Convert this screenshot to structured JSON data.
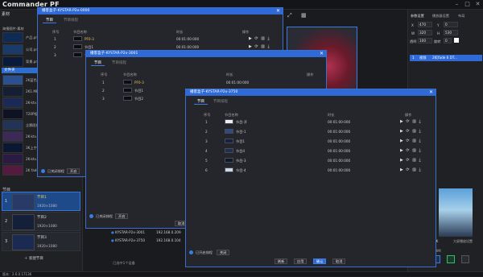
{
  "app": {
    "title": "Commander PF",
    "version_label": "版本：2.6.0.17136"
  },
  "left": {
    "header": "素材",
    "subheader": "海报图片-素材",
    "files": [
      "产品.png",
      "公司.png",
      "背景.png"
    ],
    "folder": "文件夹",
    "items": [
      "2K蓝色...",
      "2K1.MP4",
      "2K-ktv...",
      "720P视频",
      "企鹅图片",
      "2K-ktv...",
      "3K上宁吧",
      "2K-ktv...",
      "2K fade...",
      "公司展示..."
    ],
    "programs_label": "节目",
    "programs": [
      {
        "num": "1",
        "name": "节目1",
        "res": "1920×1080"
      },
      {
        "num": "2",
        "name": "节目2",
        "res": "1920×1080"
      },
      {
        "num": "3",
        "name": "节目3",
        "res": "1920×1080"
      }
    ],
    "new_program": "新建节目"
  },
  "right": {
    "tabs": [
      "参数设置",
      "播放器设置",
      "布局"
    ],
    "pos_x_label": "X",
    "pos_x": "470",
    "pos_y_label": "Y",
    "pos_y": "0",
    "size_w_label": "W",
    "size_w": "320",
    "size_h_label": "H",
    "size_h": "530",
    "opacity_label": "透明",
    "opacity": "100",
    "rotate_label": "旋转",
    "rotate": "0",
    "layer_row": {
      "num": "1",
      "type": "视频",
      "name": "2K[fade 6 DT..."
    },
    "stage_caption": "2K",
    "stage_info": "大屏播放设置",
    "bottom_label": "HDMI"
  },
  "dialog1": {
    "title": "播客盒子-KYSTAR-P2x-0000",
    "tabs": [
      "节目",
      "节目排程"
    ],
    "headers": [
      "序号",
      "节目名称",
      "时长",
      "操作"
    ],
    "rows": [
      {
        "idx": "1",
        "name": "PF0-3",
        "dur": "00:01:00:000",
        "ops": "▶ ⟳ ▥ ⤓"
      },
      {
        "idx": "2",
        "name": "节目1",
        "dur": "00:01:00:000",
        "ops": "▶ ⟳ ▥ ⤓"
      },
      {
        "idx": "3",
        "name": "节目2",
        "dur": "00:01:00:000",
        "ops": "▶ ⟳ ▥ ⤓"
      }
    ],
    "schedule_label": "已关闭排程",
    "toggle_label": "开启"
  },
  "dialog2": {
    "title": "播客盒子-KYSTAR-P2x-3001",
    "tabs": [
      "节目",
      "节目排程"
    ],
    "headers": [
      "序号",
      "节目名称",
      "时长",
      "操作"
    ],
    "rows": [
      {
        "idx": "1",
        "name": "PF0-3",
        "dur": "00:01:00:000",
        "ops": "▶ ⟳ ▥ ⤓"
      },
      {
        "idx": "2",
        "name": "节目1",
        "dur": "00:01:00:000",
        "ops": "▶ ⟳ ▥ ⤓"
      },
      {
        "idx": "3",
        "name": "节目2",
        "dur": "00:01:00:000",
        "ops": "▶ ⟳ ▥ ⤓"
      }
    ],
    "schedule_label": "已关闭排程",
    "toggle_label": "开启",
    "devices": [
      {
        "name": "KYSTAR-P2x-3001",
        "ip": "192.168.0.209"
      },
      {
        "name": "KYSTAR-P2x-3750",
        "ip": "192.168.0.104"
      }
    ],
    "selected_count": "已选中1个设备",
    "cancel_label": "取消"
  },
  "dialog3": {
    "title": "播客盒子-KYSTAR-P2x-3750",
    "tabs": [
      "节目",
      "节目排程"
    ],
    "headers": [
      "序号",
      "节目名称",
      "时长",
      "操作"
    ],
    "rows": [
      {
        "idx": "1",
        "name": "节目-开",
        "dur": "00:01:00:000",
        "ops": "▶ ⟳ ▥ ⤓"
      },
      {
        "idx": "2",
        "name": "节目-1",
        "dur": "00:01:00:000",
        "ops": "▶ ⟳ ▥ ⤓"
      },
      {
        "idx": "3",
        "name": "节目1",
        "dur": "00:01:00:000",
        "ops": "▶ ⟳ ▥ ⤓"
      },
      {
        "idx": "4",
        "name": "节目4",
        "dur": "00:01:00:000",
        "ops": "▶ ⟳ ▥ ⤓"
      },
      {
        "idx": "5",
        "name": "节目-3",
        "dur": "00:01:00:000",
        "ops": "▶ ⟳ ▥ ⤓"
      },
      {
        "idx": "6",
        "name": "节目-4",
        "dur": "00:01:00:000",
        "ops": "▶ ⟳ ▥ ⤓"
      }
    ],
    "schedule_label": "已开启排程",
    "toggle_label": "关闭",
    "buttons": [
      "刷新",
      "应用",
      "确认",
      "取消"
    ]
  },
  "colors": {
    "accent": "#2f6ad6",
    "bg": "#1a1b1e",
    "highlight": "#e8c25a"
  }
}
